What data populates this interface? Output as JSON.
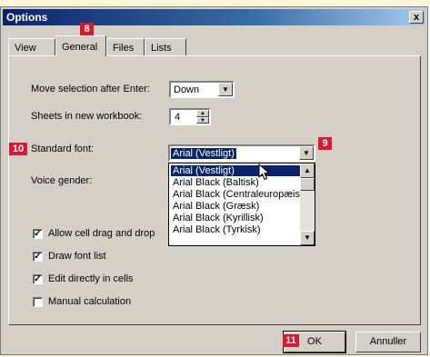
{
  "dialog": {
    "title": "Options",
    "close_label": "x"
  },
  "tabs": [
    {
      "label": "View"
    },
    {
      "label": "General"
    },
    {
      "label": "Files"
    },
    {
      "label": "Lists"
    }
  ],
  "general": {
    "move_selection_label": "Move selection after Enter:",
    "move_selection_value": "Down",
    "sheets_label": "Sheets in new workbook:",
    "sheets_value": "4",
    "standard_font_label": "Standard font:",
    "standard_font_value": "Arial (Vestligt)",
    "voice_gender_label": "Voice gender:",
    "font_options": [
      "Arial (Vestligt)",
      "Arial Black (Baltisk)",
      "Arial Black (Centraleuropæisk)",
      "Arial Black (Græsk)",
      "Arial Black (Kyrillisk)",
      "Arial Black (Tyrkisk)"
    ],
    "checkboxes": [
      {
        "label": "Allow cell drag and drop",
        "checked": true
      },
      {
        "label": "Draw font list",
        "checked": true
      },
      {
        "label": "Edit directly in cells",
        "checked": true
      },
      {
        "label": "Manual calculation",
        "checked": false
      }
    ]
  },
  "buttons": {
    "ok": "OK",
    "cancel": "Annuller"
  },
  "badges": [
    "8",
    "9",
    "10",
    "11"
  ],
  "icons": {
    "dropdown": "chevron-down-icon",
    "close": "close-icon",
    "cursor": "mouse-pointer-icon"
  },
  "colors": {
    "titlebar_start": "#0a246a",
    "titlebar_end": "#a6caf0",
    "selection": "#0a246a",
    "badge": "#d8192e",
    "dialog_face": "#d4d0c8"
  }
}
